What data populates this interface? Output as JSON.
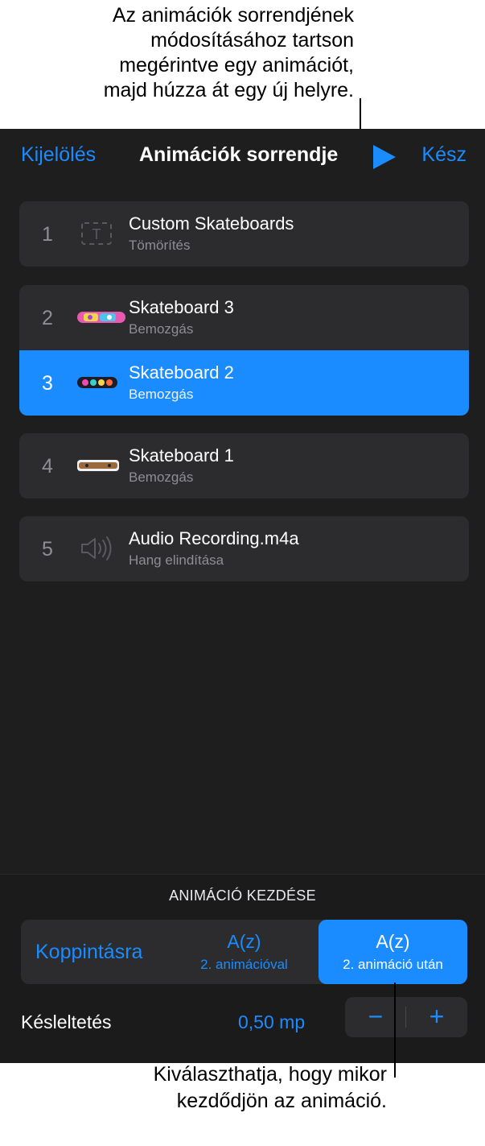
{
  "annotations": {
    "top_lines": [
      "Az animációk sorrendjének",
      "módosításához tartson",
      "megérintve egy animációt,",
      "majd húzza át egy új helyre."
    ],
    "bottom_lines": [
      "Kiválaszthatja, hogy mikor",
      "kezdődjön az animáció."
    ]
  },
  "nav": {
    "left": "Kijelölés",
    "title": "Animációk sorrendje",
    "play_icon": "play-icon",
    "right": "Kész"
  },
  "animations": [
    {
      "num": "1",
      "name": "Custom Skateboards",
      "effect": "Tömörítés",
      "icon": "text-box-icon"
    },
    {
      "num": "2",
      "name": "Skateboard 3",
      "effect": "Bemozgás",
      "icon": "skateboard-pink-thumbnail"
    },
    {
      "num": "3",
      "name": "Skateboard 2",
      "effect": "Bemozgás",
      "icon": "skateboard-colorful-thumbnail",
      "selected": true
    },
    {
      "num": "4",
      "name": "Skateboard 1",
      "effect": "Bemozgás",
      "icon": "skateboard-wood-thumbnail"
    },
    {
      "num": "5",
      "name": "Audio Recording.m4a",
      "effect": "Hang elindítása",
      "icon": "speaker-icon"
    }
  ],
  "start": {
    "header": "ANIMÁCIÓ KEZDÉSE",
    "options": [
      {
        "main": "Koppintásra",
        "sub": ""
      },
      {
        "main": "A(z)",
        "sub": "2. animációval"
      },
      {
        "main": "A(z)",
        "sub": "2. animáció után",
        "selected": true
      }
    ],
    "delay_label": "Késleltetés",
    "delay_value": "0,50 mp",
    "minus": "−",
    "plus": "+"
  },
  "colors": {
    "accent": "#1a8cff",
    "panel": "#1e1e1f",
    "row": "#2c2c2e"
  }
}
